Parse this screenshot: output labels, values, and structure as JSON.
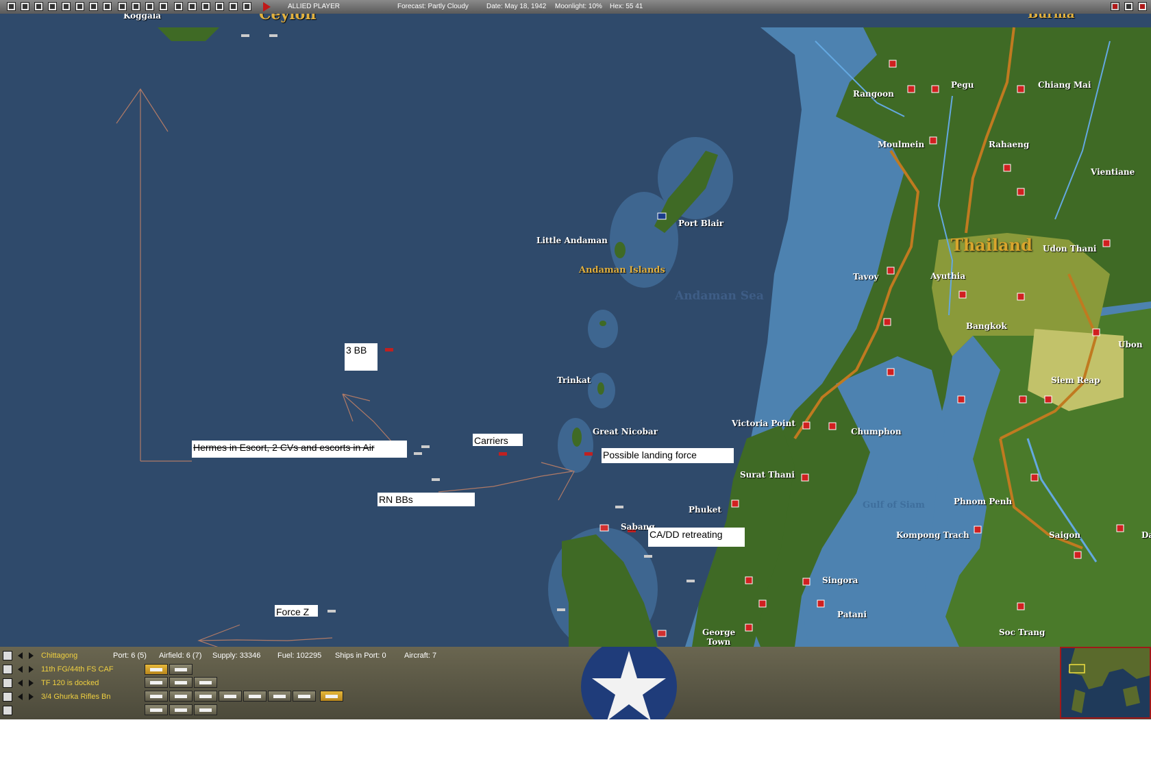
{
  "topbar": {
    "player": "ALLIED PLAYER",
    "forecast": "Forecast: Partly Cloudy",
    "date": "Date: May 18, 1942",
    "moonlight": "Moonlight: 10%",
    "hex": "Hex: 55 41"
  },
  "map": {
    "places": {
      "koggala": "Koggala",
      "ceylon": "Ceylon",
      "burma": "Burma",
      "rangoon": "Rangoon",
      "pegu": "Pegu",
      "chiang_mai": "Chiang Mai",
      "moulmein": "Moulmein",
      "rahaeng": "Rahaeng",
      "vientiane": "Vientiane",
      "port_blair": "Port Blair",
      "little_andaman": "Little Andaman",
      "andaman_islands": "Andaman Islands",
      "andaman_sea": "Andaman Sea",
      "thailand": "Thailand",
      "udon_thani": "Udon Thani",
      "tavoy": "Tavoy",
      "ayuthia": "Ayuthia",
      "bangkok": "Bangkok",
      "ubon": "Ubon",
      "trinkat": "Trinkat",
      "siem_reap": "Siem Reap",
      "great_nicobar": "Great Nicobar",
      "victoria_point": "Victoria Point",
      "chumphon": "Chumphon",
      "surat_thani": "Surat Thani",
      "phnom_penh": "Phnom Penh",
      "phuket": "Phuket",
      "gulf_of_siam": "Gulf of Siam",
      "sabang": "Sabang",
      "kompong_trach": "Kompong Trach",
      "saigon": "Saigon",
      "singora": "Singora",
      "patani": "Patani",
      "george_town": "George\nTown",
      "soc_trang": "Soc Trang",
      "da": "Da"
    },
    "annotations": {
      "three_bb": "3 BB",
      "hermes": "Hermes in Escort, 2 CVs and escorts in Air",
      "carriers": "Carriers",
      "landing": "Possible landing force",
      "rn_bbs": "RN BBs",
      "ca_dd": "CA/DD retreating",
      "force_z": "Force Z"
    }
  },
  "bottom": {
    "rows": [
      {
        "name": "Chittagong"
      },
      {
        "name": "11th FG/44th FS CAF"
      },
      {
        "name": "TF 120 is docked"
      },
      {
        "name": "3/4 Ghurka Rifles Bn"
      }
    ],
    "stats": {
      "port": "Port: 6 (5)",
      "airfield": "Airfield: 6 (7)",
      "supply": "Supply: 33346",
      "fuel": "Fuel: 102295",
      "ships": "Ships in Port: 0",
      "aircraft": "Aircraft: 7"
    }
  },
  "colors": {
    "sea_deep": "#2f4a6b",
    "sea_shallow": "#4d82b0",
    "land": "#3f6a25",
    "highlight": "#f0d040",
    "annotation_arrow": "#b07a66"
  }
}
